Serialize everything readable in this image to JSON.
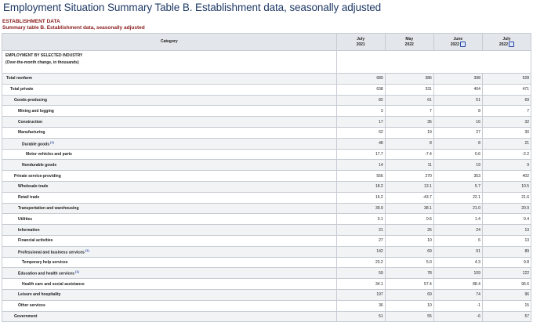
{
  "page": {
    "title": "Employment Situation Summary Table B. Establishment data, seasonally adjusted",
    "section": "ESTABLISHMENT DATA",
    "caption": "Summary table B. Establishment data, seasonally adjusted"
  },
  "table": {
    "category_header": "Category",
    "columns": [
      {
        "month": "July",
        "year": "2021",
        "footnote": ""
      },
      {
        "month": "May",
        "year": "2022",
        "footnote": ""
      },
      {
        "month": "June",
        "year": "2022",
        "footnote": "(P)"
      },
      {
        "month": "July",
        "year": "2022",
        "footnote": "(P)"
      }
    ],
    "group_label_1": "EMPLOYMENT BY SELECTED INDUSTRY",
    "group_label_2": "(Over-the-month change, in thousands)",
    "rows": [
      {
        "label": "Total nonfarm",
        "fn": "",
        "level": 0,
        "values": [
          "689",
          "386",
          "398",
          "528"
        ]
      },
      {
        "label": "Total private",
        "fn": "",
        "level": 1,
        "values": [
          "638",
          "331",
          "404",
          "471"
        ]
      },
      {
        "label": "Goods-producing",
        "fn": "",
        "level": 2,
        "values": [
          "82",
          "61",
          "51",
          "69"
        ]
      },
      {
        "label": "Mining and logging",
        "fn": "",
        "level": 3,
        "values": [
          "3",
          "7",
          "8",
          "7"
        ]
      },
      {
        "label": "Construction",
        "fn": "",
        "level": 3,
        "values": [
          "17",
          "35",
          "16",
          "32"
        ]
      },
      {
        "label": "Manufacturing",
        "fn": "",
        "level": 3,
        "values": [
          "62",
          "19",
          "27",
          "30"
        ]
      },
      {
        "label": "Durable goods",
        "fn": "(1)",
        "level": 4,
        "values": [
          "48",
          "8",
          "8",
          "21"
        ]
      },
      {
        "label": "Motor vehicles and parts",
        "fn": "",
        "level": 5,
        "values": [
          "17.7",
          "-7.4",
          "0.6",
          "-2.2"
        ]
      },
      {
        "label": "Nondurable goods",
        "fn": "",
        "level": 4,
        "values": [
          "14",
          "11",
          "19",
          "9"
        ]
      },
      {
        "label": "Private service-providing",
        "fn": "",
        "level": 2,
        "values": [
          "556",
          "270",
          "353",
          "402"
        ]
      },
      {
        "label": "Wholesale trade",
        "fn": "",
        "level": 3,
        "values": [
          "18.2",
          "13.1",
          "5.7",
          "10.5"
        ]
      },
      {
        "label": "Retail trade",
        "fn": "",
        "level": 3,
        "values": [
          "16.2",
          "-43.7",
          "22.1",
          "21.6"
        ]
      },
      {
        "label": "Transportation and warehousing",
        "fn": "",
        "level": 3,
        "values": [
          "39.9",
          "38.1",
          "21.0",
          "20.9"
        ]
      },
      {
        "label": "Utilities",
        "fn": "",
        "level": 3,
        "values": [
          "0.1",
          "0.6",
          "1.4",
          "0.4"
        ]
      },
      {
        "label": "Information",
        "fn": "",
        "level": 3,
        "values": [
          "21",
          "26",
          "24",
          "13"
        ]
      },
      {
        "label": "Financial activities",
        "fn": "",
        "level": 3,
        "values": [
          "27",
          "10",
          "6",
          "13"
        ]
      },
      {
        "label": "Professional and business services",
        "fn": "(1)",
        "level": 3,
        "values": [
          "142",
          "69",
          "91",
          "89"
        ]
      },
      {
        "label": "Temporary help services",
        "fn": "",
        "level": 4,
        "values": [
          "23.2",
          "5.0",
          "4.3",
          "9.8"
        ]
      },
      {
        "label": "Education and health services",
        "fn": "(1)",
        "level": 3,
        "values": [
          "59",
          "78",
          "109",
          "122"
        ]
      },
      {
        "label": "Health care and social assistance",
        "fn": "",
        "level": 4,
        "values": [
          "34.1",
          "57.4",
          "88.4",
          "96.6"
        ]
      },
      {
        "label": "Leisure and hospitality",
        "fn": "",
        "level": 3,
        "values": [
          "197",
          "69",
          "74",
          "96"
        ]
      },
      {
        "label": "Other services",
        "fn": "",
        "level": 3,
        "values": [
          "36",
          "10",
          "-1",
          "15"
        ]
      },
      {
        "label": "Government",
        "fn": "",
        "level": 2,
        "values": [
          "51",
          "55",
          "-6",
          "57"
        ]
      }
    ]
  }
}
